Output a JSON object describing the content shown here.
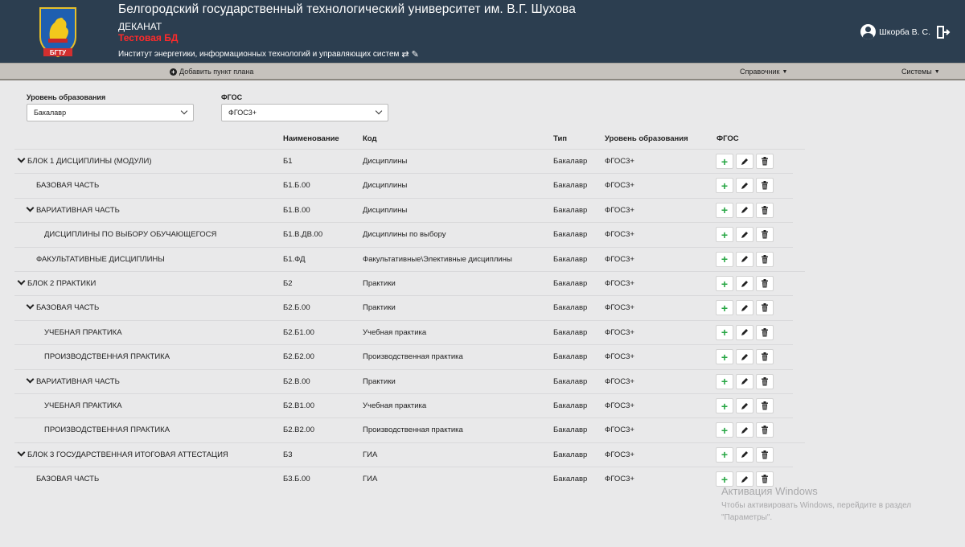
{
  "header": {
    "logo_text": "БГТУ",
    "university": "Белгородский государственный технологический университет им. В.Г. Шухова",
    "department": "ДЕКАНАТ",
    "test_db": "Тестовая БД",
    "institute": "Институт энергетики, информационных технологий и управляющих систем",
    "user": "Шкорба В. С."
  },
  "menu": {
    "add_plan_item": "Добавить пункт плана",
    "directory": "Справочник",
    "systems": "Системы"
  },
  "filters": {
    "level_label": "Уровень образования",
    "level_value": "Бакалавр",
    "fgos_label": "ФГОС",
    "fgos_value": "ФГОС3+"
  },
  "table": {
    "headers": {
      "name": "Наименование",
      "code": "Код",
      "type": "Тип",
      "level": "Уровень образования",
      "fgos": "ФГОС"
    },
    "rows": [
      {
        "label": "БЛОК 1 ДИСЦИПЛИНЫ (МОДУЛИ)",
        "name": "Б1",
        "code": "Дисциплины",
        "type": "Бакалавр",
        "fgos": "ФГОС3+",
        "indent": 0,
        "expanded": true
      },
      {
        "label": "БАЗОВАЯ ЧАСТЬ",
        "name": "Б1.Б.00",
        "code": "Дисциплины",
        "type": "Бакалавр",
        "fgos": "ФГОС3+",
        "indent": 1,
        "expanded": false
      },
      {
        "label": "ВАРИАТИВНАЯ ЧАСТЬ",
        "name": "Б1.В.00",
        "code": "Дисциплины",
        "type": "Бакалавр",
        "fgos": "ФГОС3+",
        "indent": 1,
        "expanded": true
      },
      {
        "label": "ДИСЦИПЛИНЫ ПО ВЫБОРУ ОБУЧАЮЩЕГОСЯ",
        "name": "Б1.В.ДВ.00",
        "code": "Дисциплины по выбору",
        "type": "Бакалавр",
        "fgos": "ФГОС3+",
        "indent": 2,
        "expanded": false
      },
      {
        "label": "ФАКУЛЬТАТИВНЫЕ ДИСЦИПЛИНЫ",
        "name": "Б1.ФД",
        "code": "Факультативные\\Элективные дисциплины",
        "type": "Бакалавр",
        "fgos": "ФГОС3+",
        "indent": 1,
        "expanded": false
      },
      {
        "label": "БЛОК 2 ПРАКТИКИ",
        "name": "Б2",
        "code": "Практики",
        "type": "Бакалавр",
        "fgos": "ФГОС3+",
        "indent": 0,
        "expanded": true
      },
      {
        "label": "БАЗОВАЯ ЧАСТЬ",
        "name": "Б2.Б.00",
        "code": "Практики",
        "type": "Бакалавр",
        "fgos": "ФГОС3+",
        "indent": 1,
        "expanded": true
      },
      {
        "label": "УЧЕБНАЯ ПРАКТИКА",
        "name": "Б2.Б1.00",
        "code": "Учебная практика",
        "type": "Бакалавр",
        "fgos": "ФГОС3+",
        "indent": 2,
        "expanded": false
      },
      {
        "label": "ПРОИЗВОДСТВЕННАЯ ПРАКТИКА",
        "name": "Б2.Б2.00",
        "code": "Производственная практика",
        "type": "Бакалавр",
        "fgos": "ФГОС3+",
        "indent": 2,
        "expanded": false
      },
      {
        "label": "ВАРИАТИВНАЯ ЧАСТЬ",
        "name": "Б2.В.00",
        "code": "Практики",
        "type": "Бакалавр",
        "fgos": "ФГОС3+",
        "indent": 1,
        "expanded": true
      },
      {
        "label": "УЧЕБНАЯ ПРАКТИКА",
        "name": "Б2.В1.00",
        "code": "Учебная практика",
        "type": "Бакалавр",
        "fgos": "ФГОС3+",
        "indent": 2,
        "expanded": false
      },
      {
        "label": "ПРОИЗВОДСТВЕННАЯ ПРАКТИКА",
        "name": "Б2.В2.00",
        "code": "Производственная практика",
        "type": "Бакалавр",
        "fgos": "ФГОС3+",
        "indent": 2,
        "expanded": false
      },
      {
        "label": "БЛОК 3 ГОСУДАРСТВЕННАЯ ИТОГОВАЯ АТТЕСТАЦИЯ",
        "name": "Б3",
        "code": "ГИА",
        "type": "Бакалавр",
        "fgos": "ФГОС3+",
        "indent": 0,
        "expanded": true
      },
      {
        "label": "БАЗОВАЯ ЧАСТЬ",
        "name": "Б3.Б.00",
        "code": "ГИА",
        "type": "Бакалавр",
        "fgos": "ФГОС3+",
        "indent": 1,
        "expanded": false
      }
    ]
  },
  "watermark": {
    "title": "Активация Windows",
    "line1": "Чтобы активировать Windows, перейдите в раздел",
    "line2": "\"Параметры\"."
  },
  "colors": {
    "header_bg": "#2c3e50",
    "menubar_bg": "#c6c2bd",
    "test_db": "#ff2a2a",
    "add_button": "#28a745"
  }
}
